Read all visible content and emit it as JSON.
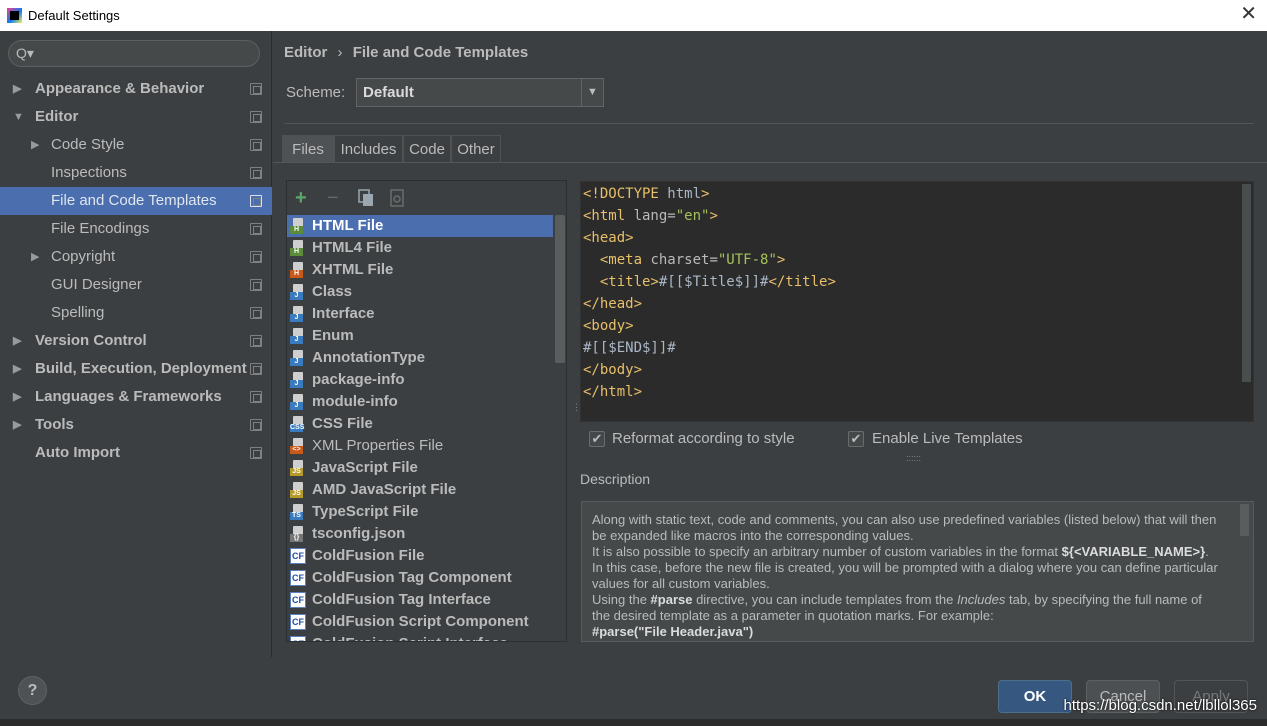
{
  "window": {
    "title": "Default Settings",
    "close_glyph": "✕"
  },
  "search": {
    "icon": "search-icon",
    "glyph": "Q▾"
  },
  "sidebar": {
    "items": [
      {
        "label": "Appearance & Behavior",
        "bold": true,
        "expander": "▶",
        "indent": 0
      },
      {
        "label": "Editor",
        "bold": true,
        "expander": "▼",
        "indent": 0
      },
      {
        "label": "Code Style",
        "bold": false,
        "expander": "▶",
        "indent": 1
      },
      {
        "label": "Inspections",
        "bold": false,
        "expander": "",
        "indent": 1
      },
      {
        "label": "File and Code Templates",
        "bold": false,
        "expander": "",
        "indent": 1,
        "selected": true
      },
      {
        "label": "File Encodings",
        "bold": false,
        "expander": "",
        "indent": 1
      },
      {
        "label": "Copyright",
        "bold": false,
        "expander": "▶",
        "indent": 1
      },
      {
        "label": "GUI Designer",
        "bold": false,
        "expander": "",
        "indent": 1
      },
      {
        "label": "Spelling",
        "bold": false,
        "expander": "",
        "indent": 1
      },
      {
        "label": "Version Control",
        "bold": true,
        "expander": "▶",
        "indent": 0
      },
      {
        "label": "Build, Execution, Deployment",
        "bold": true,
        "expander": "▶",
        "indent": 0
      },
      {
        "label": "Languages & Frameworks",
        "bold": true,
        "expander": "▶",
        "indent": 0
      },
      {
        "label": "Tools",
        "bold": true,
        "expander": "▶",
        "indent": 0
      },
      {
        "label": "Auto Import",
        "bold": true,
        "expander": "",
        "indent": 0
      }
    ]
  },
  "breadcrumb": {
    "part1": "Editor",
    "sep": "›",
    "part2": "File and Code Templates"
  },
  "scheme": {
    "label": "Scheme:",
    "value": "Default",
    "dropdown_glyph": "▼"
  },
  "tabs": [
    "Files",
    "Includes",
    "Code",
    "Other"
  ],
  "selected_tab": "Files",
  "toolbar": {
    "add": "+",
    "remove": "−"
  },
  "files": [
    {
      "name": "HTML File",
      "badge": "H",
      "badge_color": "#5b8c3a",
      "bold": true,
      "selected": true
    },
    {
      "name": "HTML4 File",
      "badge": "H",
      "badge_color": "#5b8c3a",
      "bold": true
    },
    {
      "name": "XHTML File",
      "badge": "H",
      "badge_color": "#c75a1a",
      "bold": true
    },
    {
      "name": "Class",
      "badge": "J",
      "badge_color": "#3a7bbf",
      "bold": true
    },
    {
      "name": "Interface",
      "badge": "J",
      "badge_color": "#3a7bbf",
      "bold": true
    },
    {
      "name": "Enum",
      "badge": "J",
      "badge_color": "#3a7bbf",
      "bold": true
    },
    {
      "name": "AnnotationType",
      "badge": "J",
      "badge_color": "#3a7bbf",
      "bold": true
    },
    {
      "name": "package-info",
      "badge": "J",
      "badge_color": "#3a7bbf",
      "bold": true
    },
    {
      "name": "module-info",
      "badge": "J",
      "badge_color": "#3a7bbf",
      "bold": true
    },
    {
      "name": "CSS File",
      "badge": "CSS",
      "badge_color": "#3a7bbf",
      "bold": true
    },
    {
      "name": "XML Properties File",
      "badge": "<>",
      "badge_color": "#c75a1a",
      "bold": false
    },
    {
      "name": "JavaScript File",
      "badge": "JS",
      "badge_color": "#b59a2a",
      "bold": true
    },
    {
      "name": "AMD JavaScript File",
      "badge": "JS",
      "badge_color": "#b59a2a",
      "bold": true
    },
    {
      "name": "TypeScript File",
      "badge": "TS",
      "badge_color": "#3a7bbf",
      "bold": true
    },
    {
      "name": "tsconfig.json",
      "badge": "{}",
      "badge_color": "#777777",
      "bold": true
    },
    {
      "name": "ColdFusion File",
      "badge": "CF",
      "badge_color": "cf",
      "bold": true
    },
    {
      "name": "ColdFusion Tag Component",
      "badge": "CF",
      "badge_color": "cf",
      "bold": true
    },
    {
      "name": "ColdFusion Tag Interface",
      "badge": "CF",
      "badge_color": "cf",
      "bold": true
    },
    {
      "name": "ColdFusion Script Component",
      "badge": "CF",
      "badge_color": "cf",
      "bold": true
    },
    {
      "name": "ColdFusion Script Interface",
      "badge": "CF",
      "badge_color": "cf",
      "bold": true
    }
  ],
  "editor": {
    "lines": [
      [
        {
          "t": "t",
          "s": "<!DOCTYPE "
        },
        {
          "t": "x",
          "s": "html"
        },
        {
          "t": "t",
          "s": ">"
        }
      ],
      [
        {
          "t": "t",
          "s": "<html "
        },
        {
          "t": "a",
          "s": "lang="
        },
        {
          "t": "v",
          "s": "\"en\""
        },
        {
          "t": "t",
          "s": ">"
        }
      ],
      [
        {
          "t": "t",
          "s": "<head>"
        }
      ],
      [
        {
          "t": "x",
          "s": "  "
        },
        {
          "t": "t",
          "s": "<meta "
        },
        {
          "t": "a",
          "s": "charset="
        },
        {
          "t": "v",
          "s": "\"UTF-8\""
        },
        {
          "t": "t",
          "s": ">"
        }
      ],
      [
        {
          "t": "x",
          "s": "  "
        },
        {
          "t": "t",
          "s": "<title>"
        },
        {
          "t": "x",
          "s": "#[[$Title$]]#"
        },
        {
          "t": "t",
          "s": "</title>"
        }
      ],
      [
        {
          "t": "t",
          "s": "</head>"
        }
      ],
      [
        {
          "t": "t",
          "s": "<body>"
        }
      ],
      [
        {
          "t": "x",
          "s": "#[[$END$]]#"
        }
      ],
      [
        {
          "t": "t",
          "s": "</body>"
        }
      ],
      [
        {
          "t": "t",
          "s": "</html>"
        }
      ]
    ]
  },
  "options": {
    "reformat": {
      "label": "Reformat according to style",
      "checked": true
    },
    "live_templates": {
      "label": "Enable Live Templates",
      "checked": true
    }
  },
  "description": {
    "label": "Description",
    "paragraphs": [
      "Along with static text, code and comments, you can also use predefined variables (listed below) that will then be expanded like macros into the corresponding values.",
      "It is also possible to specify an arbitrary number of custom variables in the format ",
      "${<VARIABLE_NAME>}",
      ". In this case, before the new file is created, you will be prompted with a dialog where you can define particular values for all custom variables.",
      "Using the ",
      "#parse",
      " directive, you can include templates from the ",
      "Includes",
      " tab, by specifying the full name of the desired template as a parameter in quotation marks. For example:",
      "#parse(\"File Header.java\")"
    ]
  },
  "buttons": {
    "help": "?",
    "ok": "OK",
    "cancel": "Cancel",
    "apply": "Apply"
  },
  "watermark": "https://blog.csdn.net/lbllol365"
}
